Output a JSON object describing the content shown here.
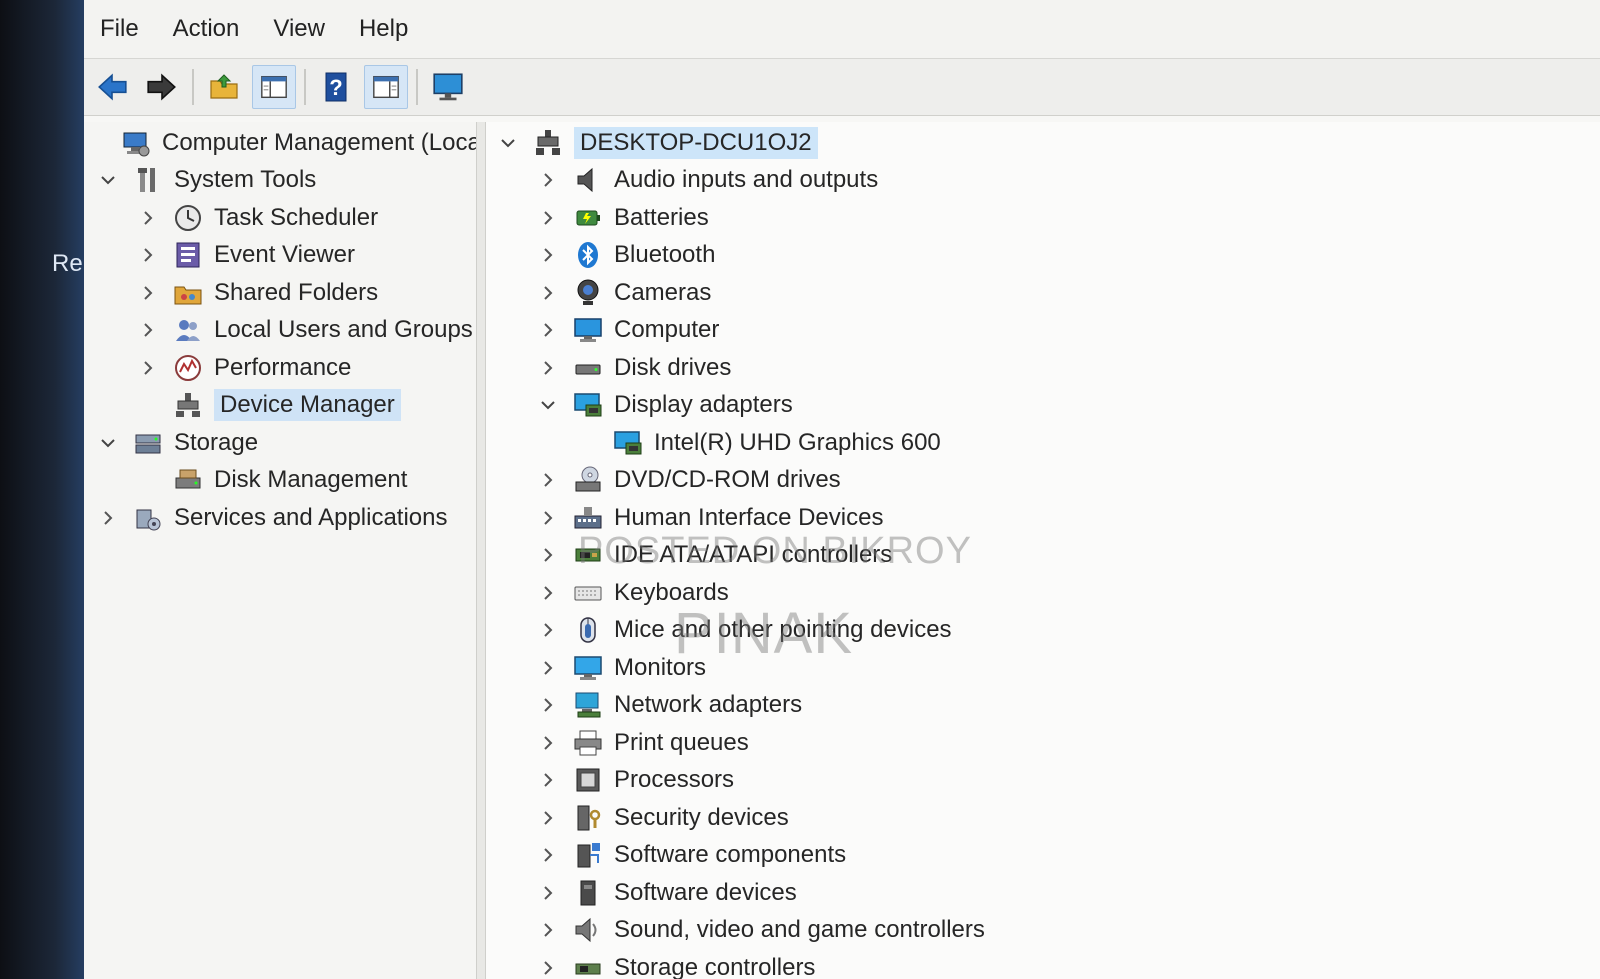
{
  "desktop": {
    "partial_label": "Re"
  },
  "menu": [
    "File",
    "Action",
    "View",
    "Help"
  ],
  "toolbar": {
    "buttons": [
      {
        "name": "back-arrow-icon",
        "pressed": false
      },
      {
        "name": "forward-arrow-icon",
        "pressed": false
      },
      {
        "name": "up-folder-icon",
        "pressed": false
      },
      {
        "name": "show-hide-console-tree-icon",
        "pressed": true
      },
      {
        "name": "help-icon",
        "pressed": false
      },
      {
        "name": "show-hide-action-pane-icon",
        "pressed": true
      },
      {
        "name": "monitor-icon",
        "pressed": false
      }
    ]
  },
  "tree": {
    "root": "Computer Management (Local",
    "items": [
      {
        "label": "System Tools",
        "expanded": true,
        "level": 1,
        "icon": "tools-icon"
      },
      {
        "label": "Task Scheduler",
        "expanded": false,
        "level": 2,
        "icon": "clock-icon"
      },
      {
        "label": "Event Viewer",
        "expanded": false,
        "level": 2,
        "icon": "event-viewer-icon"
      },
      {
        "label": "Shared Folders",
        "expanded": false,
        "level": 2,
        "icon": "shared-folder-icon"
      },
      {
        "label": "Local Users and Groups",
        "expanded": false,
        "level": 2,
        "icon": "users-icon"
      },
      {
        "label": "Performance",
        "expanded": false,
        "level": 2,
        "icon": "performance-icon"
      },
      {
        "label": "Device Manager",
        "expanded": null,
        "level": 2,
        "icon": "device-manager-icon",
        "selected": true
      },
      {
        "label": "Storage",
        "expanded": true,
        "level": 1,
        "icon": "storage-icon"
      },
      {
        "label": "Disk Management",
        "expanded": null,
        "level": 2,
        "icon": "disk-management-icon"
      },
      {
        "label": "Services and Applications",
        "expanded": false,
        "level": 1,
        "icon": "services-icon"
      }
    ]
  },
  "devices": {
    "root": "DESKTOP-DCU1OJ2",
    "items": [
      {
        "label": "Audio inputs and outputs",
        "icon": "speaker-icon"
      },
      {
        "label": "Batteries",
        "icon": "battery-icon"
      },
      {
        "label": "Bluetooth",
        "icon": "bluetooth-icon"
      },
      {
        "label": "Cameras",
        "icon": "camera-icon"
      },
      {
        "label": "Computer",
        "icon": "computer-icon"
      },
      {
        "label": "Disk drives",
        "icon": "disk-drive-icon"
      },
      {
        "label": "Display adapters",
        "icon": "display-adapter-icon",
        "expanded": true
      },
      {
        "label": "Intel(R) UHD Graphics 600",
        "icon": "display-adapter-icon",
        "child": true
      },
      {
        "label": "DVD/CD-ROM drives",
        "icon": "dvd-icon"
      },
      {
        "label": "Human Interface Devices",
        "icon": "hid-icon"
      },
      {
        "label": "IDE ATA/ATAPI controllers",
        "icon": "ide-controller-icon"
      },
      {
        "label": "Keyboards",
        "icon": "keyboard-icon"
      },
      {
        "label": "Mice and other pointing devices",
        "icon": "mouse-icon"
      },
      {
        "label": "Monitors",
        "icon": "monitor-icon"
      },
      {
        "label": "Network adapters",
        "icon": "network-icon"
      },
      {
        "label": "Print queues",
        "icon": "printer-icon"
      },
      {
        "label": "Processors",
        "icon": "processor-icon"
      },
      {
        "label": "Security devices",
        "icon": "security-icon"
      },
      {
        "label": "Software components",
        "icon": "software-component-icon"
      },
      {
        "label": "Software devices",
        "icon": "software-device-icon"
      },
      {
        "label": "Sound, video and game controllers",
        "icon": "sound-icon"
      },
      {
        "label": "Storage controllers",
        "icon": "storage-controller-icon"
      }
    ]
  },
  "watermark": {
    "line1": "POSTED ON BIKROY",
    "line2": "PINAK"
  }
}
